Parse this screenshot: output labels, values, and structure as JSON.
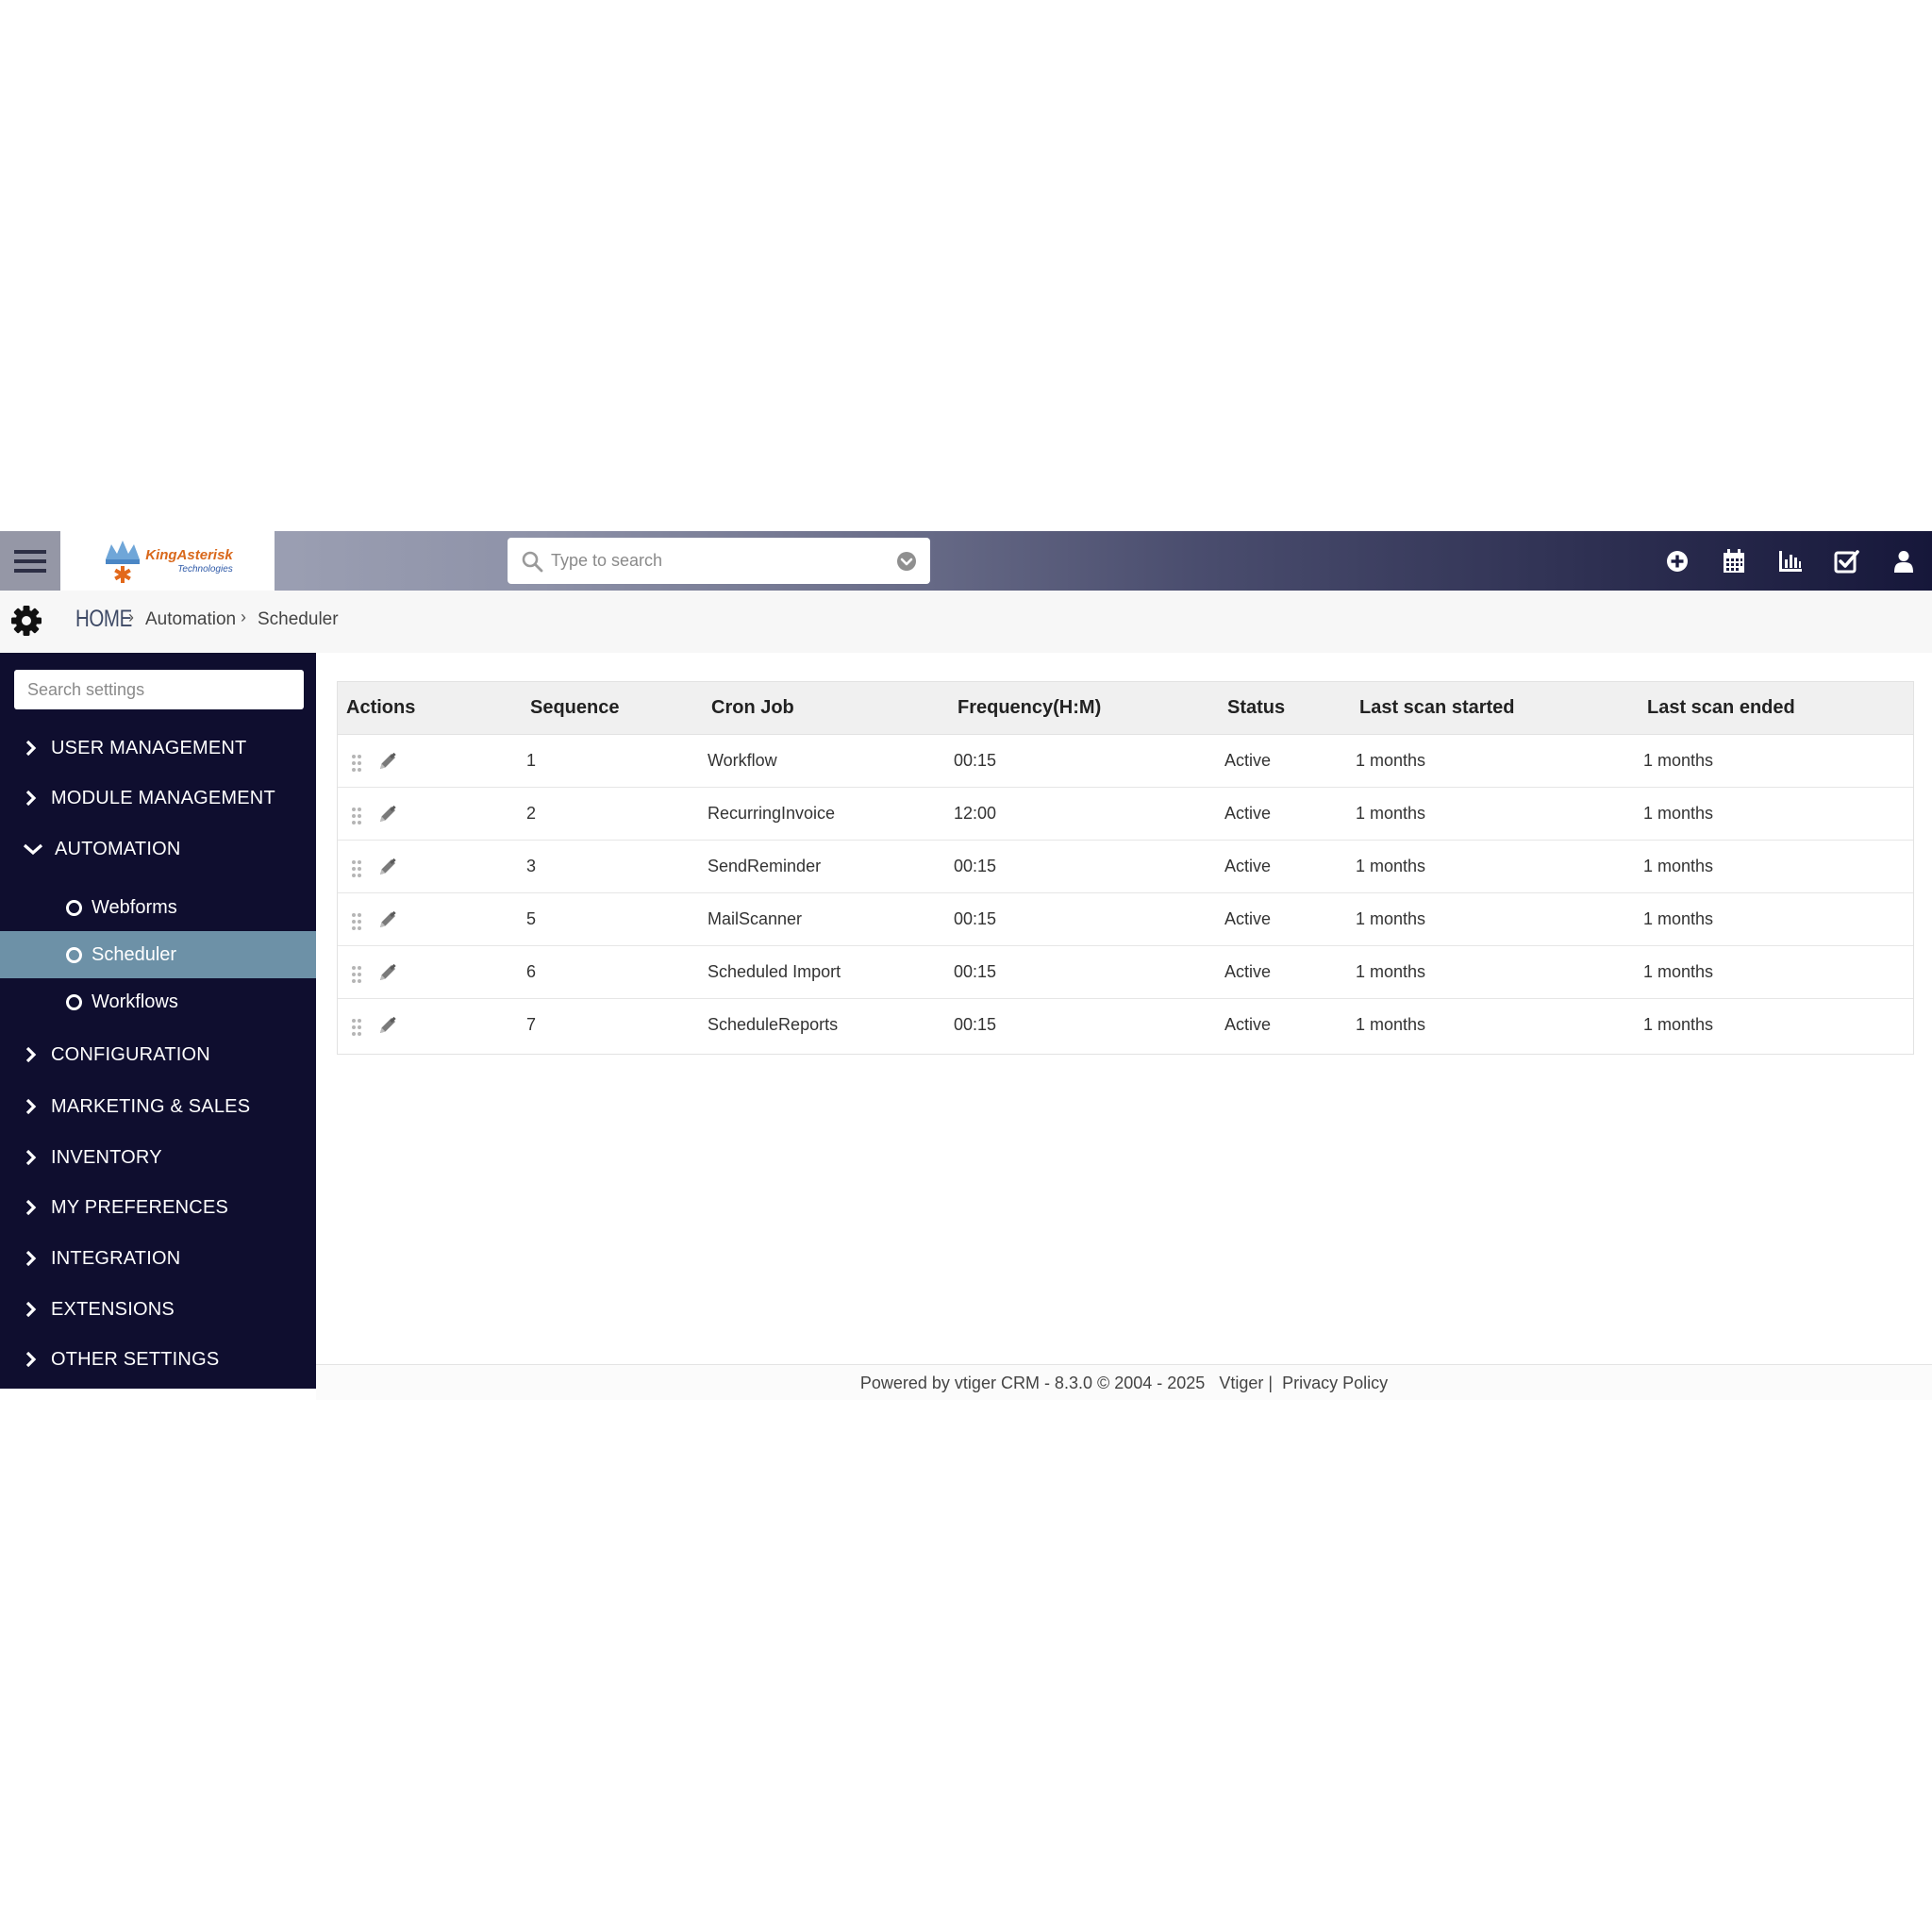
{
  "header": {
    "logo": {
      "name": "KingAsterisk",
      "sub": "Technologies"
    },
    "search_placeholder": "Type to search"
  },
  "breadcrumb": {
    "home": "HOME",
    "items": [
      "Automation",
      "Scheduler"
    ]
  },
  "sidebar": {
    "search_placeholder": "Search settings",
    "sections": [
      {
        "label": "USER MANAGEMENT"
      },
      {
        "label": "MODULE MANAGEMENT"
      },
      {
        "label": "AUTOMATION"
      },
      {
        "label": "CONFIGURATION"
      },
      {
        "label": "MARKETING & SALES"
      },
      {
        "label": "INVENTORY"
      },
      {
        "label": "MY PREFERENCES"
      },
      {
        "label": "INTEGRATION"
      },
      {
        "label": "EXTENSIONS"
      },
      {
        "label": "OTHER SETTINGS"
      }
    ],
    "automation_items": [
      {
        "label": "Webforms"
      },
      {
        "label": "Scheduler"
      },
      {
        "label": "Workflows"
      }
    ]
  },
  "table": {
    "headers": [
      "Actions",
      "Sequence",
      "Cron Job",
      "Frequency(H:M)",
      "Status",
      "Last scan started",
      "Last scan ended"
    ],
    "rows": [
      {
        "sequence": "1",
        "job": "Workflow",
        "frequency": "00:15",
        "status": "Active",
        "started": "1 months",
        "ended": "1 months"
      },
      {
        "sequence": "2",
        "job": "RecurringInvoice",
        "frequency": "12:00",
        "status": "Active",
        "started": "1 months",
        "ended": "1 months"
      },
      {
        "sequence": "3",
        "job": "SendReminder",
        "frequency": "00:15",
        "status": "Active",
        "started": "1 months",
        "ended": "1 months"
      },
      {
        "sequence": "5",
        "job": "MailScanner",
        "frequency": "00:15",
        "status": "Active",
        "started": "1 months",
        "ended": "1 months"
      },
      {
        "sequence": "6",
        "job": "Scheduled Import",
        "frequency": "00:15",
        "status": "Active",
        "started": "1 months",
        "ended": "1 months"
      },
      {
        "sequence": "7",
        "job": "ScheduleReports",
        "frequency": "00:15",
        "status": "Active",
        "started": "1 months",
        "ended": "1 months"
      }
    ]
  },
  "footer": {
    "text": "Powered by vtiger CRM - 8.3.0  © 2004 - 2025",
    "vtiger_link": "Vtiger",
    "separator": "|",
    "privacy_link": "Privacy Policy"
  }
}
